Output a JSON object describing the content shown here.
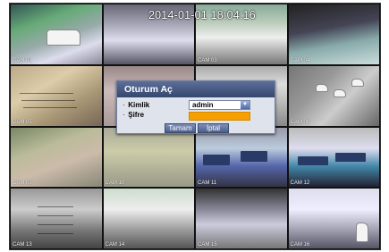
{
  "osd": {
    "datetime": "2014-01-01 18:04:16"
  },
  "cameras": [
    {
      "label": "CAM 01"
    },
    {
      "label": ""
    },
    {
      "label": "CAM 03"
    },
    {
      "label": "CAM 04"
    },
    {
      "label": "CAM 05"
    },
    {
      "label": ""
    },
    {
      "label": ""
    },
    {
      "label": "CAM 08"
    },
    {
      "label": "CAM 09"
    },
    {
      "label": "CAM 10"
    },
    {
      "label": "CAM 11"
    },
    {
      "label": "CAM 12"
    },
    {
      "label": "CAM 13"
    },
    {
      "label": "CAM 14"
    },
    {
      "label": "CAM 15"
    },
    {
      "label": "CAM 16"
    }
  ],
  "login_dialog": {
    "title": "Oturum Aç",
    "kimlik_label": "Kimlik",
    "kimlik_value": "admin",
    "sifre_label": "Şifre",
    "sifre_value": "",
    "ok_label": "Tamam",
    "cancel_label": "İptal",
    "bullet": "·"
  },
  "colors": {
    "titlebar": "#36466d",
    "password_highlight": "#f5a000"
  }
}
